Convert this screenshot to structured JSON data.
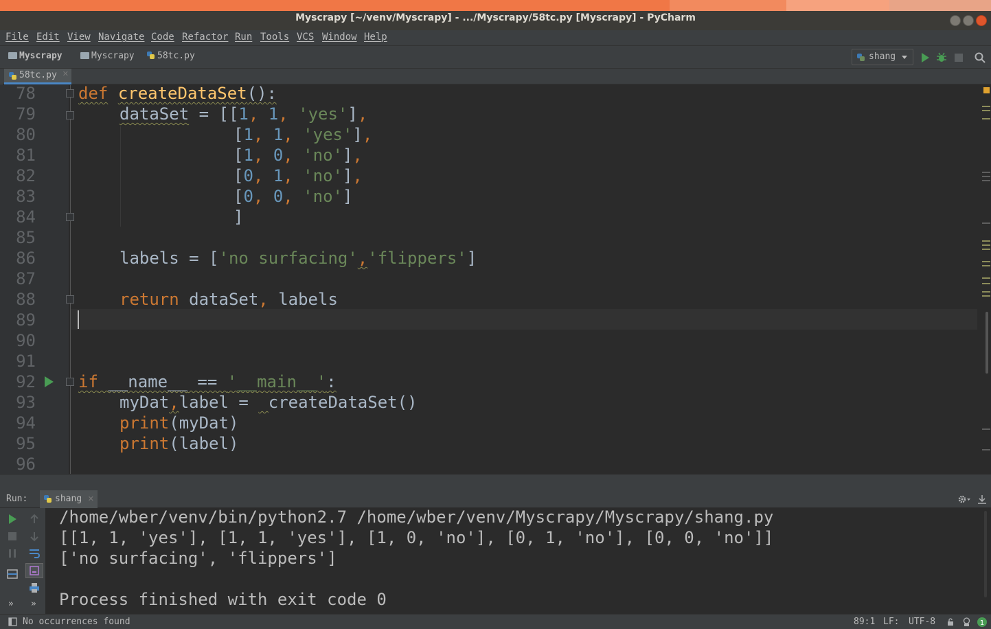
{
  "window": {
    "title": "Myscrapy [~/venv/Myscrapy] - .../Myscrapy/58tc.py [Myscrapy] - PyCharm"
  },
  "menu": [
    "File",
    "Edit",
    "View",
    "Navigate",
    "Code",
    "Refactor",
    "Run",
    "Tools",
    "VCS",
    "Window",
    "Help"
  ],
  "breadcrumb": {
    "project": "Myscrapy",
    "folder": "Myscrapy",
    "file": "58tc.py"
  },
  "run_config": {
    "name": "shang"
  },
  "editor_tab": {
    "label": "58tc.py"
  },
  "editor": {
    "line_numbers": [
      "78",
      "79",
      "80",
      "81",
      "82",
      "83",
      "84",
      "85",
      "86",
      "87",
      "88",
      "89",
      "90",
      "91",
      "92",
      "93",
      "94",
      "95",
      "96"
    ],
    "code": {
      "l78": {
        "kw": "def",
        "fn": "createDataSet",
        "rest": "():"
      },
      "l79": {
        "var": "dataSet",
        "eq": " = [[",
        "n1": "1",
        "c1": ", ",
        "n2": "1",
        "c2": ", ",
        "s": "'yes'",
        "end": "],",
        "endc": ","
      },
      "l80": {
        "open": "[",
        "n1": "1",
        "c1": ", ",
        "n2": "1",
        "c2": ", ",
        "s": "'yes'",
        "end": "]",
        "endc": ","
      },
      "l81": {
        "open": "[",
        "n1": "1",
        "c1": ", ",
        "n2": "0",
        "c2": ", ",
        "s": "'no'",
        "end": "]",
        "endc": ","
      },
      "l82": {
        "open": "[",
        "n1": "0",
        "c1": ", ",
        "n2": "1",
        "c2": ", ",
        "s": "'no'",
        "end": "]",
        "endc": ","
      },
      "l83": {
        "open": "[",
        "n1": "0",
        "c1": ", ",
        "n2": "0",
        "c2": ", ",
        "s": "'no'",
        "end": "]"
      },
      "l84": {
        "close": "]"
      },
      "l86": {
        "var": "labels = [",
        "s1": "'no surfacing'",
        "c": ",",
        "s2": "'flippers'",
        "end": "]"
      },
      "l88": {
        "kw": "return",
        "rest": " dataSet",
        "c": ",",
        "rest2": " labels"
      },
      "l92": {
        "kw": "if",
        "sp": " ",
        "name": "__name__",
        "eq": " == ",
        "s": "'__main__'",
        "end": ":"
      },
      "l93": {
        "a": "myDat",
        "c": ",",
        "b": "label = ",
        "sp": " ",
        "call": "createDataSet()"
      },
      "l94": {
        "bi": "print",
        "rest": "(myDat)"
      },
      "l95": {
        "bi": "print",
        "rest": "(label)"
      }
    }
  },
  "run_panel": {
    "label": "Run:",
    "tab": "shang",
    "console": [
      "/home/wber/venv/bin/python2.7 /home/wber/venv/Myscrapy/Myscrapy/shang.py",
      "[[1, 1, 'yes'], [1, 1, 'yes'], [1, 0, 'no'], [0, 1, 'no'], [0, 0, 'no']]",
      "['no surfacing', 'flippers']",
      "",
      "Process finished with exit code 0"
    ]
  },
  "status": {
    "message": "No occurrences found",
    "position": "89:1",
    "line_sep": "LF:",
    "encoding": "UTF-8"
  },
  "colors": {
    "keyword": "#cc7832",
    "function": "#ffc66d",
    "string": "#6a8759",
    "number": "#6897bb",
    "builtin": "#8888c6",
    "editor_bg": "#2b2b2b",
    "title_accent": "#f07746"
  }
}
